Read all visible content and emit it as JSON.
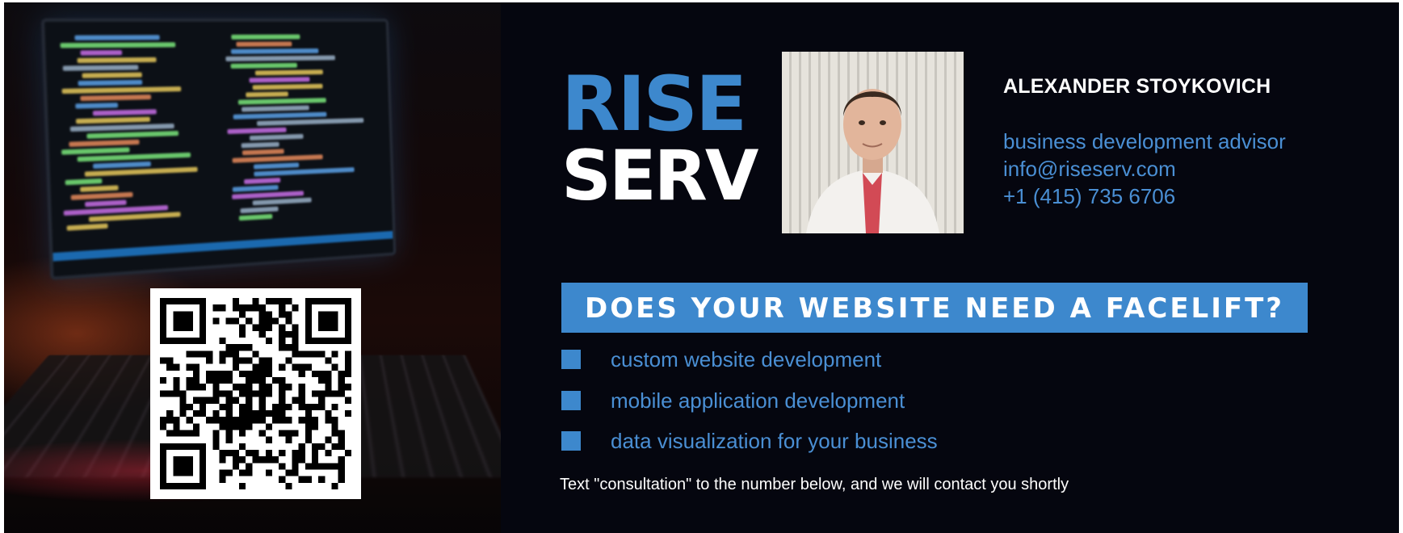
{
  "brand": {
    "logo_top": "RISE",
    "logo_bottom": "SERV",
    "primary_color": "#3d88cd",
    "background_color": "#05060f"
  },
  "contact": {
    "name": "ALEXANDER STOYKOVICH",
    "role": "business development advisor",
    "email": "info@riseserv.com",
    "phone": "+1 (415) 735 6706"
  },
  "banner": {
    "headline": "DOES YOUR WEBSITE NEED A FACELIFT?"
  },
  "services": [
    {
      "label": "custom website development"
    },
    {
      "label": "mobile application development"
    },
    {
      "label": "data visualization for your business"
    }
  ],
  "cta": {
    "text": "Text \"consultation\" to the number below, and we will contact you shortly"
  },
  "images": {
    "background_photo": "computer-monitor-with-code",
    "qr_code": "qr-code",
    "portrait": "man-in-white-shirt-portrait"
  }
}
